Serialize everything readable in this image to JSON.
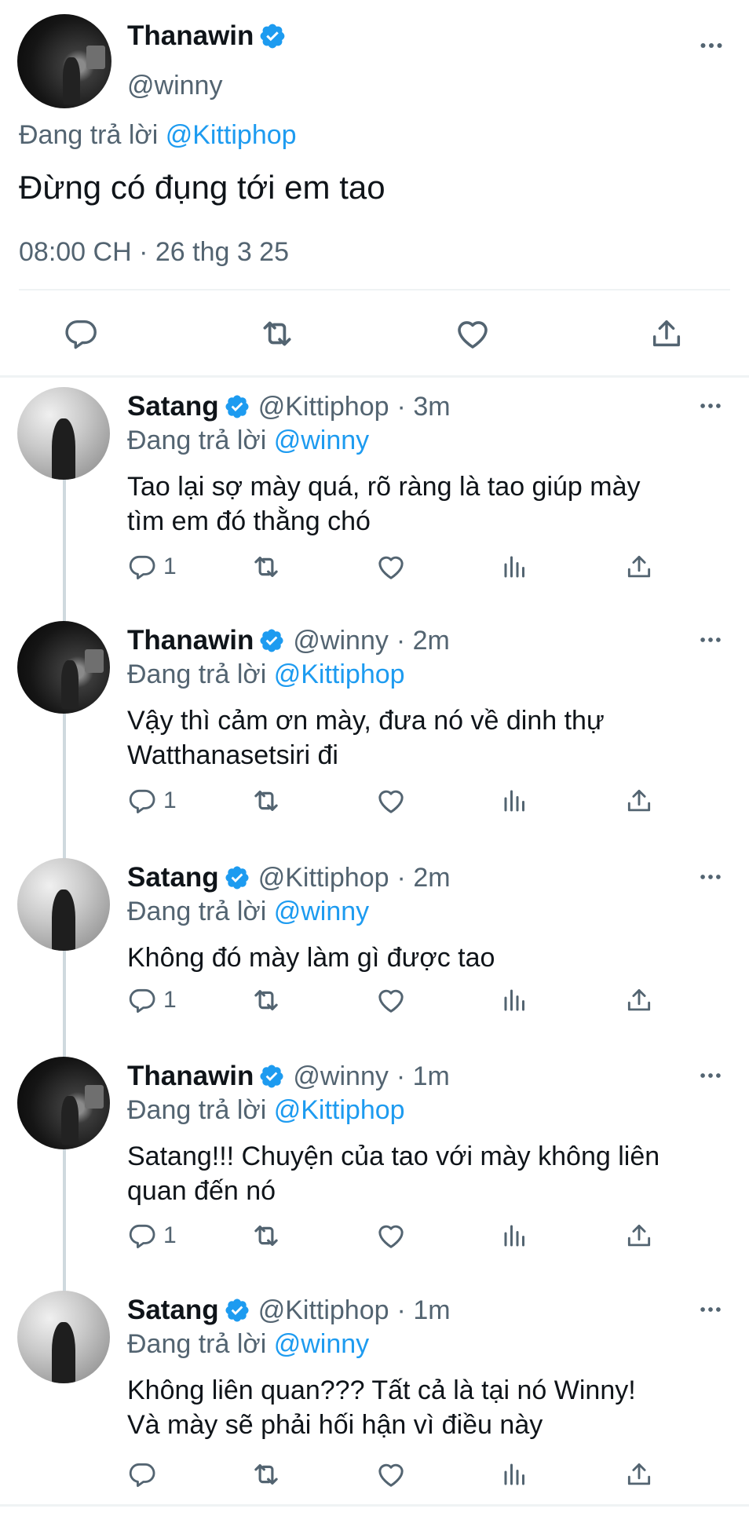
{
  "main_tweet": {
    "name": "Thanawin",
    "handle": "@winny",
    "reply_prefix": "Đang trả lời",
    "reply_to": "@Kittiphop",
    "text": "Đừng có đụng tới em tao",
    "meta": "08:00 CH · 26 thg 3 25"
  },
  "replies": [
    {
      "name": "Satang",
      "handle": "@Kittiphop",
      "time": "· 3m",
      "reply_prefix": "Đang trả lời",
      "reply_to": "@winny",
      "text": "Tao lại sợ mày quá, rõ ràng là tao giúp mày\ntìm em đó thằng chó",
      "reply_count": "1"
    },
    {
      "name": "Thanawin",
      "handle": "@winny",
      "time": "· 2m",
      "reply_prefix": "Đang trả lời",
      "reply_to": "@Kittiphop",
      "text": "Vậy thì cảm ơn mày, đưa nó về dinh thự\nWatthanasetsiri đi",
      "reply_count": "1"
    },
    {
      "name": "Satang",
      "handle": "@Kittiphop",
      "time": "· 2m",
      "reply_prefix": "Đang trả lời",
      "reply_to": "@winny",
      "text": "Không đó mày làm gì được tao",
      "reply_count": "1"
    },
    {
      "name": "Thanawin",
      "handle": "@winny",
      "time": "· 1m",
      "reply_prefix": "Đang trả lời",
      "reply_to": "@Kittiphop",
      "text": "Satang!!! Chuyện của tao với mày không liên\nquan đến nó",
      "reply_count": "1"
    },
    {
      "name": "Satang",
      "handle": "@Kittiphop",
      "time": "· 1m",
      "reply_prefix": "Đang trả lời",
      "reply_to": "@winny",
      "text": "Không liên quan??? Tất cả là tại nó Winny!\nVà mày sẽ phải hối hận vì điều này",
      "reply_count": ""
    }
  ],
  "icons": {
    "reply": "reply-icon",
    "retweet": "retweet-icon",
    "like": "like-icon",
    "views": "views-icon",
    "share": "share-icon",
    "more": "more-icon",
    "verified": "verified-badge-icon"
  },
  "colors": {
    "accent": "#1d9bf0",
    "muted": "#536471",
    "text": "#0f1419",
    "divider": "#eff3f4"
  }
}
